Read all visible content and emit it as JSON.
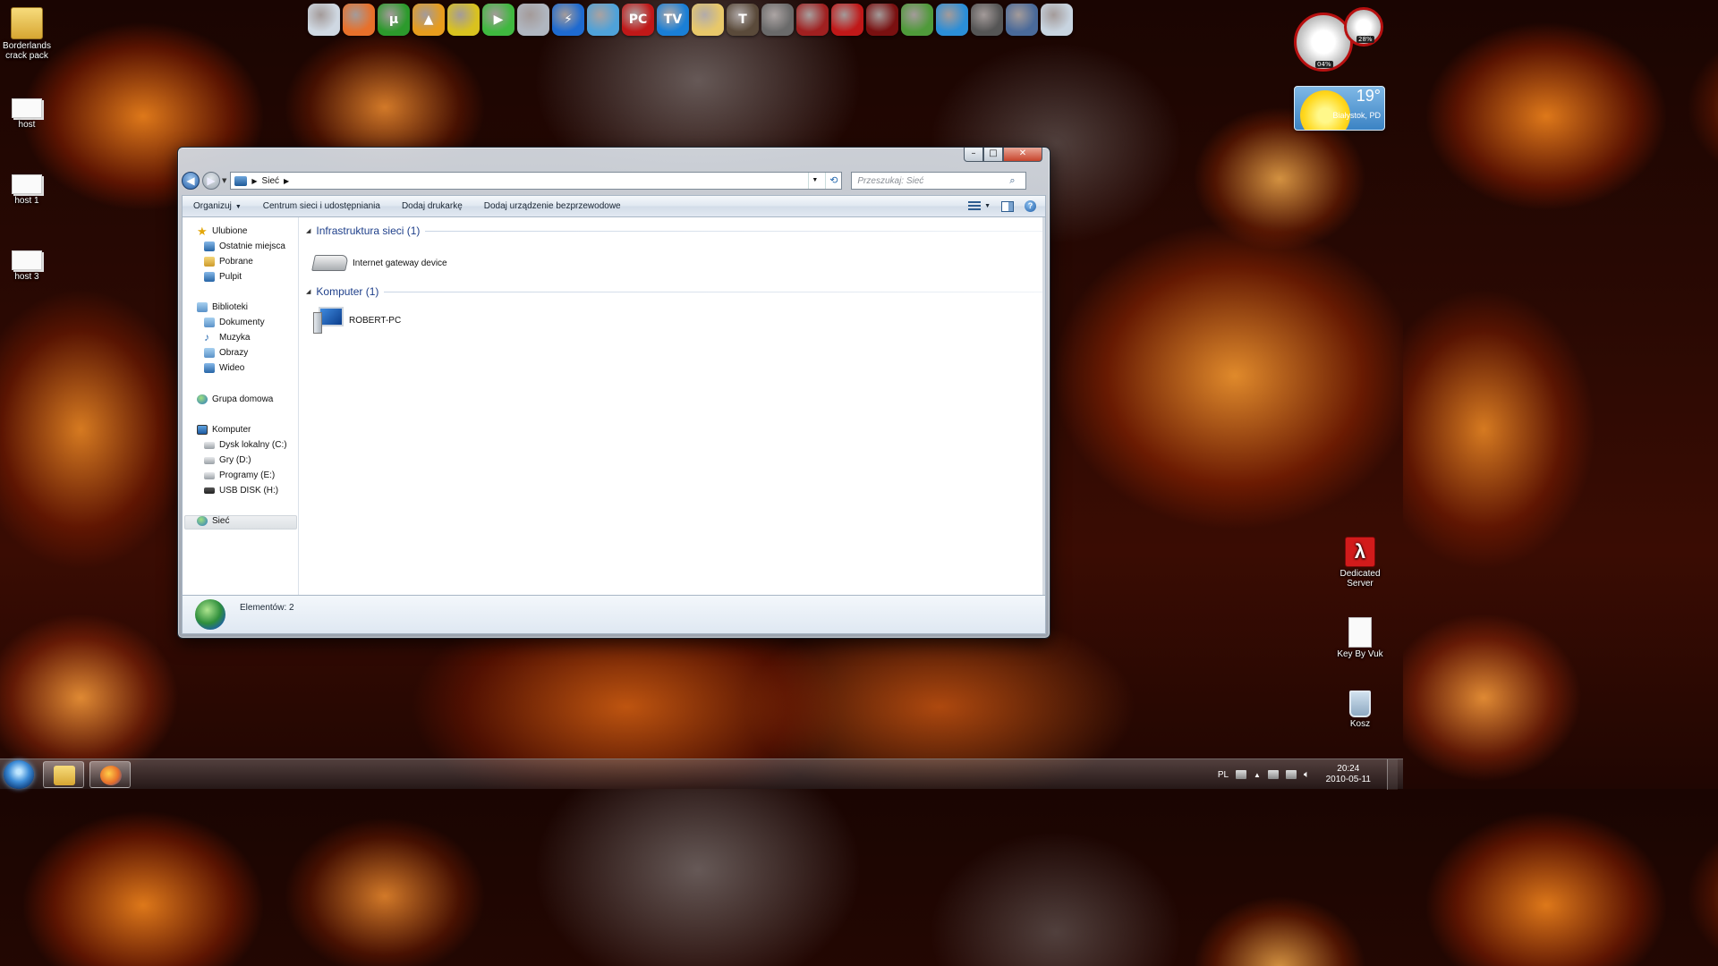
{
  "desktop": {
    "left_icons": [
      {
        "label": "Borderlands crack pack",
        "icon": "folder-icon"
      },
      {
        "label": "host",
        "icon": "document-icon"
      },
      {
        "label": "host 1",
        "icon": "document-icon"
      },
      {
        "label": "host 3",
        "icon": "document-icon"
      }
    ],
    "right_icons": [
      {
        "label": "Dedicated Server",
        "icon": "half-life-icon"
      },
      {
        "label": "Key By Vuk",
        "icon": "text-file-icon"
      },
      {
        "label": "Kosz",
        "icon": "recycle-bin-icon"
      }
    ]
  },
  "dock": {
    "icons": [
      {
        "name": "notepad-icon",
        "glyph": "",
        "color": "#cfd8e2"
      },
      {
        "name": "firefox-icon",
        "glyph": "",
        "color": "#e8702a"
      },
      {
        "name": "utorrent-icon",
        "glyph": "µ",
        "color": "#2c9a2c"
      },
      {
        "name": "aimp-icon",
        "glyph": "▲",
        "color": "#e79c1d"
      },
      {
        "name": "lightbulb-icon",
        "glyph": "",
        "color": "#d9c21f"
      },
      {
        "name": "media-player-icon",
        "glyph": "▶",
        "color": "#3fb83f"
      },
      {
        "name": "browser-orb-icon",
        "glyph": "",
        "color": "#b0b6c0"
      },
      {
        "name": "daemon-tools-icon",
        "glyph": "⚡",
        "color": "#1e6ad0"
      },
      {
        "name": "drive-tool-icon",
        "glyph": "",
        "color": "#4fa2d9"
      },
      {
        "name": "pc-game-icon",
        "glyph": "PC",
        "color": "#c01818"
      },
      {
        "name": "jlc-tv-icon",
        "glyph": "TV",
        "color": "#1a7fd6"
      },
      {
        "name": "fallout-vault-boy-icon",
        "glyph": "",
        "color": "#e8c86a"
      },
      {
        "name": "tribes-icon",
        "glyph": "T",
        "color": "#5a4a3a"
      },
      {
        "name": "just-cause-icon",
        "glyph": "",
        "color": "#6a6a6a"
      },
      {
        "name": "skull-game-icon",
        "glyph": "",
        "color": "#a02020"
      },
      {
        "name": "borderlands-icon",
        "glyph": "",
        "color": "#c01818"
      },
      {
        "name": "metro-icon",
        "glyph": "",
        "color": "#7a1010"
      },
      {
        "name": "flower-game-icon",
        "glyph": "",
        "color": "#4f9a3a"
      },
      {
        "name": "spiral-icon",
        "glyph": "",
        "color": "#2b8ed8"
      },
      {
        "name": "shield-game-icon",
        "glyph": "",
        "color": "#555"
      },
      {
        "name": "counter-strike-icon",
        "glyph": "",
        "color": "#4a6a9a"
      },
      {
        "name": "recycle-bin-icon",
        "glyph": "",
        "color": "#c8d4e0"
      }
    ]
  },
  "gadgets": {
    "cpu_meter": {
      "cpu_percent": "04%",
      "ram_percent": "28%"
    },
    "weather": {
      "temperature": "19°",
      "location": "Białystok, PD"
    }
  },
  "window": {
    "controls": {
      "minimize": "–",
      "maximize": "□",
      "close": "✕"
    },
    "breadcrumb": {
      "location": "Sieć"
    },
    "search_placeholder": "Przeszukaj: Sieć",
    "toolbar": {
      "organize": "Organizuj",
      "network_center": "Centrum sieci i udostępniania",
      "add_printer": "Dodaj drukarkę",
      "add_wireless": "Dodaj urządzenie bezprzewodowe"
    },
    "nav_pane": {
      "favorites": {
        "label": "Ulubione",
        "items": [
          "Ostatnie miejsca",
          "Pobrane",
          "Pulpit"
        ]
      },
      "libraries": {
        "label": "Biblioteki",
        "items": [
          "Dokumenty",
          "Muzyka",
          "Obrazy",
          "Wideo"
        ]
      },
      "homegroup": {
        "label": "Grupa domowa"
      },
      "computer": {
        "label": "Komputer",
        "items": [
          "Dysk lokalny (C:)",
          "Gry (D:)",
          "Programy (E:)",
          "USB DISK (H:)"
        ]
      },
      "network": {
        "label": "Sieć"
      }
    },
    "groups": [
      {
        "title": "Infrastruktura sieci (1)",
        "items": [
          "Internet gateway device"
        ]
      },
      {
        "title": "Komputer (1)",
        "items": [
          "ROBERT-PC"
        ]
      }
    ],
    "status_bar": {
      "item_count": "Elementów: 2"
    }
  },
  "taskbar": {
    "language": "PL",
    "time": "20:24",
    "date": "2010-05-11"
  }
}
